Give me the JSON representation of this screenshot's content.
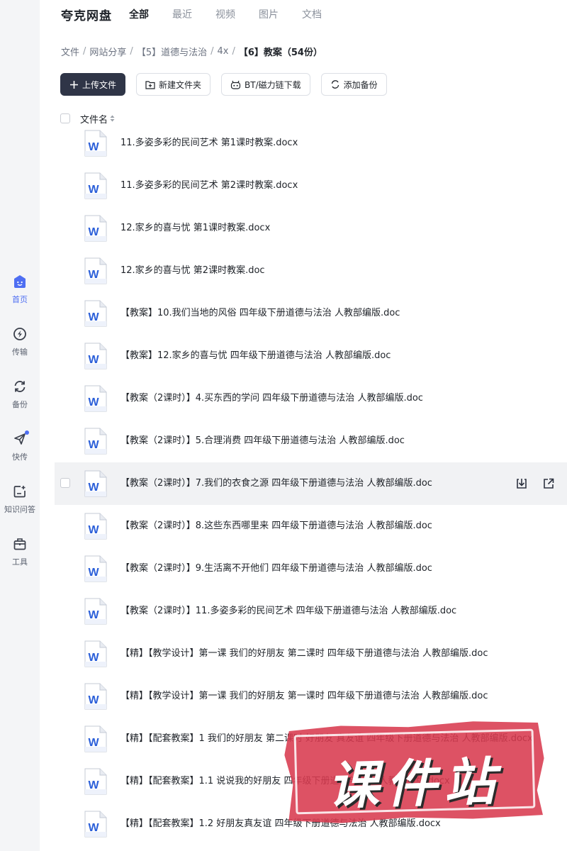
{
  "app": {
    "brand": "夸克网盘"
  },
  "header": {
    "tabs": [
      "全部",
      "最近",
      "视频",
      "图片",
      "文档"
    ],
    "active_tab": "全部"
  },
  "sidebar": {
    "items": [
      {
        "label": "首页",
        "icon": "home-face-icon",
        "active": true
      },
      {
        "label": "传输",
        "icon": "transfer-icon",
        "active": false
      },
      {
        "label": "备份",
        "icon": "backup-sync-icon",
        "active": false
      },
      {
        "label": "快传",
        "icon": "quick-send-icon",
        "active": false,
        "dot": true
      },
      {
        "label": "知识问答",
        "icon": "knowledge-qa-icon",
        "active": false
      },
      {
        "label": "工具",
        "icon": "toolbox-icon",
        "active": false
      }
    ]
  },
  "breadcrumb": [
    "文件",
    "网站分享",
    "【5】道德与法治",
    "4x",
    "【6】教案（54份）"
  ],
  "toolbar": {
    "upload": "上传文件",
    "new_folder": "新建文件夹",
    "bt_download": "BT/磁力链下载",
    "add_backup": "添加备份"
  },
  "list": {
    "header": "文件名",
    "files": [
      "11.多姿多彩的民间艺术 第1课时教案.docx",
      "11.多姿多彩的民间艺术 第2课时教案.docx",
      "12.家乡的喜与忧 第1课时教案.docx",
      "12.家乡的喜与忧 第2课时教案.doc",
      "【教案】10.我们当地的风俗 四年级下册道德与法治 人教部编版.doc",
      "【教案】12.家乡的喜与忧 四年级下册道德与法治 人教部编版.doc",
      "【教案（2课时）】4.买东西的学问 四年级下册道德与法治 人教部编版.doc",
      "【教案（2课时）】5.合理消费 四年级下册道德与法治 人教部编版.doc",
      "【教案（2课时）】7.我们的衣食之源 四年级下册道德与法治 人教部编版.doc",
      "【教案（2课时）】8.这些东西哪里来 四年级下册道德与法治 人教部编版.doc",
      "【教案（2课时）】9.生活离不开他们 四年级下册道德与法治 人教部编版.doc",
      "【教案（2课时）】11.多姿多彩的民间艺术 四年级下册道德与法治 人教部编版.doc",
      "【精】【教学设计】第一课 我们的好朋友 第二课时 四年级下册道德与法治 人教部编版.doc",
      "【精】【教学设计】第一课 我们的好朋友 第一课时 四年级下册道德与法治 人教部编版.doc",
      "【精】【配套教案】1 我们的好朋友 第二课时 好朋友 真友谊 四年级下册道德与法治 人教部编版.docx",
      "【精】【配套教案】1.1 说说我的好朋友 四年级下册道德与法治 人教部编版.docx",
      "【精】【配套教案】1.2 好朋友真友谊 四年级下册道德与法治 人教部编版.docx"
    ],
    "hover_row": 8
  },
  "watermark": {
    "text": "课件站"
  },
  "colors": {
    "accent": "#4e6ef2",
    "primary_button": "#2f3547",
    "word_blue": "#2b5fd9",
    "stamp_red": "#d83a4f"
  }
}
